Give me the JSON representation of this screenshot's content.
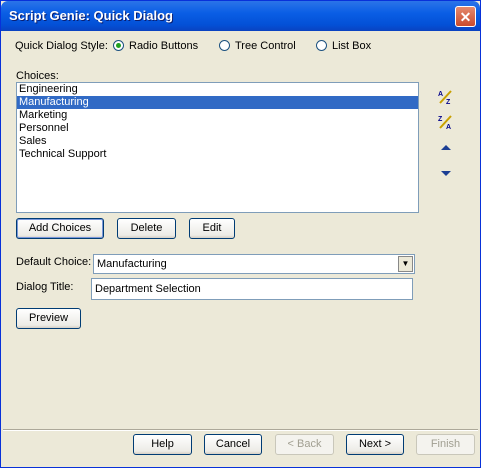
{
  "window": {
    "title": "Script Genie:  Quick Dialog",
    "close_glyph": "✕"
  },
  "style": {
    "label": "Quick Dialog Style:",
    "options": [
      "Radio Buttons",
      "Tree Control",
      "List Box"
    ],
    "selected": "Radio Buttons"
  },
  "choices": {
    "label": "Choices:",
    "items": [
      "Engineering",
      "Manufacturing",
      "Marketing",
      "Personnel",
      "Sales",
      "Technical Support"
    ],
    "selected": "Manufacturing"
  },
  "side_icons": [
    "sort-ascending-icon",
    "sort-descending-icon",
    "move-up-icon",
    "move-down-icon"
  ],
  "buttons": {
    "add_choices": "Add Choices",
    "delete": "Delete",
    "edit": "Edit",
    "preview": "Preview",
    "help": "Help",
    "cancel": "Cancel",
    "back": "< Back",
    "next": "Next >",
    "finish": "Finish"
  },
  "default_choice": {
    "label": "Default Choice:",
    "value": "Manufacturing"
  },
  "dialog_title": {
    "label": "Dialog Title:",
    "value": "Department Selection"
  },
  "colors": {
    "selection": "#316ac5",
    "title_bar": "#0a5ee5",
    "dialog_bg": "#ece9d8"
  }
}
